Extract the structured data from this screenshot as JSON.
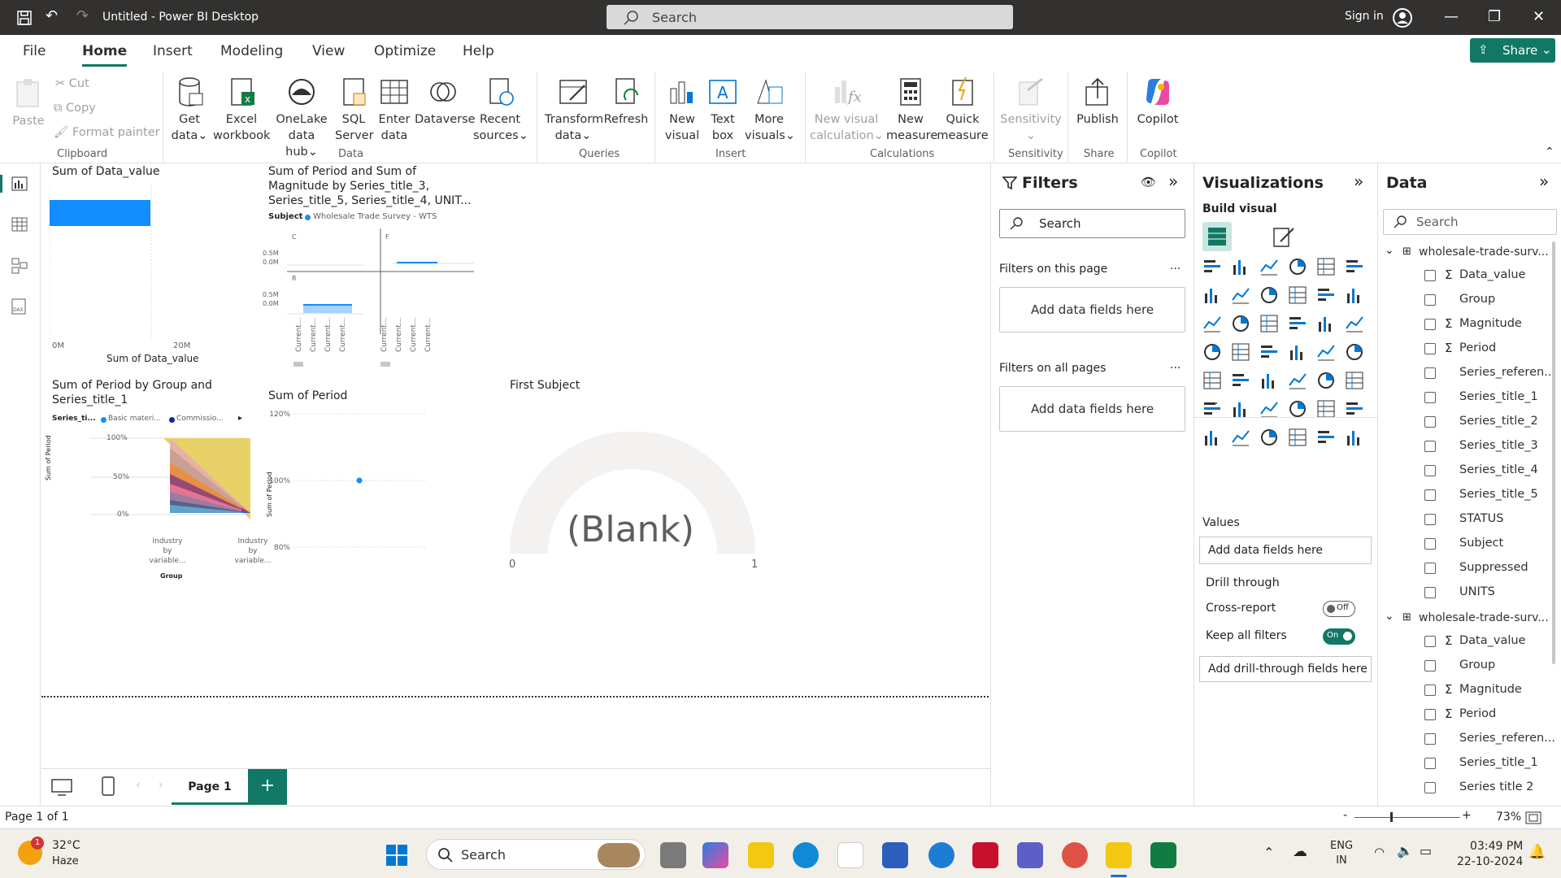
{
  "titlebar": {
    "title": "Untitled - Power BI Desktop",
    "search_placeholder": "Search",
    "sign_in": "Sign in"
  },
  "menu": {
    "items": [
      "File",
      "Home",
      "Insert",
      "Modeling",
      "View",
      "Optimize",
      "Help"
    ],
    "share": "Share"
  },
  "ribbon": {
    "clipboard": {
      "paste": "Paste",
      "cut": "Cut",
      "copy": "Copy",
      "format_painter": "Format painter",
      "group": "Clipboard"
    },
    "data": {
      "get_data": [
        "Get",
        "data"
      ],
      "excel": [
        "Excel",
        "workbook"
      ],
      "onelake": [
        "OneLake",
        "data hub"
      ],
      "sql": [
        "SQL",
        "Server"
      ],
      "enter": [
        "Enter",
        "data"
      ],
      "dataverse": "Dataverse",
      "recent": [
        "Recent",
        "sources"
      ],
      "group": "Data"
    },
    "queries": {
      "transform": [
        "Transform",
        "data"
      ],
      "refresh": "Refresh",
      "group": "Queries"
    },
    "insert": {
      "new_visual": [
        "New",
        "visual"
      ],
      "text_box": [
        "Text",
        "box"
      ],
      "more_visuals": [
        "More",
        "visuals"
      ],
      "group": "Insert"
    },
    "calculations": {
      "new_visual_calc": [
        "New visual",
        "calculation"
      ],
      "new_measure": [
        "New",
        "measure"
      ],
      "quick_measure": [
        "Quick",
        "measure"
      ],
      "group": "Calculations"
    },
    "sensitivity": {
      "label": "Sensitivity",
      "group": "Sensitivity"
    },
    "share": {
      "publish": "Publish",
      "group": "Share"
    },
    "copilot": {
      "label": "Copilot",
      "group": "Copilot"
    }
  },
  "visuals": {
    "bar": {
      "title": "Sum of Data_value",
      "tick0": "0M",
      "tick1": "20M",
      "xlabel": "Sum of Data_value"
    },
    "multi": {
      "title": [
        "Sum of Period and Sum of",
        "Magnitude by Series_title_3,",
        "Series_title_5, Series_title_4, UNIT..."
      ],
      "legend_label": "Subject",
      "legend_item": "Wholesale Trade Survey - WTS",
      "c": "C",
      "f": "F",
      "r": "R",
      "ticks": [
        "0.5M",
        "0.0M",
        "0.5M",
        "0.0M"
      ],
      "xlabels": [
        "Current...",
        "Current...",
        "Current...",
        "Current...",
        "Current...",
        "Current...",
        "Current...",
        "Current..."
      ]
    },
    "ribbon_chart": {
      "title": [
        "Sum of Period by Group and",
        "Series_title_1"
      ],
      "legend_label": "Series_ti...",
      "legend_a": "Basic materi...",
      "legend_b": "Commissio...",
      "y_ticks": [
        "100%",
        "50%",
        "0%"
      ],
      "ylabel": "Sum of Period",
      "x_a": [
        "Industry",
        "by",
        "variable..."
      ],
      "x_b": [
        "Industry",
        "by",
        "variable..."
      ],
      "xlabel": "Group"
    },
    "scatter": {
      "title": "Sum of Period",
      "y_ticks": [
        "120%",
        "100%",
        "80%"
      ],
      "ylabel": "Sum of Period"
    },
    "gauge": {
      "title": "First Subject",
      "value": "(Blank)",
      "min": "0",
      "max": "1"
    }
  },
  "chart_data": [
    {
      "type": "bar",
      "title": "Sum of Data_value",
      "categories": [
        ""
      ],
      "values": [
        15000000
      ],
      "xlim": [
        0,
        20000000
      ],
      "xlabel": "Sum of Data_value"
    },
    {
      "type": "scatter",
      "title": "Sum of Period",
      "x": [
        0
      ],
      "y": [
        1.0
      ],
      "ylim": [
        0.8,
        1.2
      ],
      "ylabel": "Sum of Period"
    }
  ],
  "filters": {
    "title": "Filters",
    "search": "Search",
    "on_page": "Filters on this page",
    "on_all": "Filters on all pages",
    "add": "Add data fields here",
    "more": "..."
  },
  "viz": {
    "title": "Visualizations",
    "build": "Build visual",
    "values": "Values",
    "add_values": "Add data fields here",
    "drill": "Drill through",
    "cross_report": "Cross-report",
    "cross_state": "Off",
    "keep_filters": "Keep all filters",
    "keep_state": "On",
    "add_drill": "Add drill-through fields here",
    "more": "..."
  },
  "data": {
    "title": "Data",
    "search": "Search",
    "table1": "wholesale-trade-surv...",
    "table2": "wholesale-trade-surv...",
    "fields1": [
      {
        "name": "Data_value",
        "sigma": "Σ"
      },
      {
        "name": "Group",
        "sigma": ""
      },
      {
        "name": "Magnitude",
        "sigma": "Σ"
      },
      {
        "name": "Period",
        "sigma": "Σ"
      },
      {
        "name": "Series_referen...",
        "sigma": ""
      },
      {
        "name": "Series_title_1",
        "sigma": ""
      },
      {
        "name": "Series_title_2",
        "sigma": ""
      },
      {
        "name": "Series_title_3",
        "sigma": ""
      },
      {
        "name": "Series_title_4",
        "sigma": ""
      },
      {
        "name": "Series_title_5",
        "sigma": ""
      },
      {
        "name": "STATUS",
        "sigma": ""
      },
      {
        "name": "Subject",
        "sigma": ""
      },
      {
        "name": "Suppressed",
        "sigma": ""
      },
      {
        "name": "UNITS",
        "sigma": ""
      }
    ],
    "fields2": [
      {
        "name": "Data_value",
        "sigma": "Σ"
      },
      {
        "name": "Group",
        "sigma": ""
      },
      {
        "name": "Magnitude",
        "sigma": "Σ"
      },
      {
        "name": "Period",
        "sigma": "Σ"
      },
      {
        "name": "Series_referen...",
        "sigma": ""
      },
      {
        "name": "Series_title_1",
        "sigma": ""
      },
      {
        "name": "Series title 2",
        "sigma": ""
      }
    ]
  },
  "pages": {
    "tab": "Page 1",
    "add": "+"
  },
  "status": {
    "page": "Page 1 of 1",
    "zoom": "73%",
    "minus": "-",
    "plus": "+"
  },
  "taskbar": {
    "temp": "32°C",
    "weather": "Haze",
    "badge": "1",
    "search": "Search",
    "lang1": "ENG",
    "lang2": "IN",
    "time": "03:49 PM",
    "date": "22-10-2024"
  }
}
